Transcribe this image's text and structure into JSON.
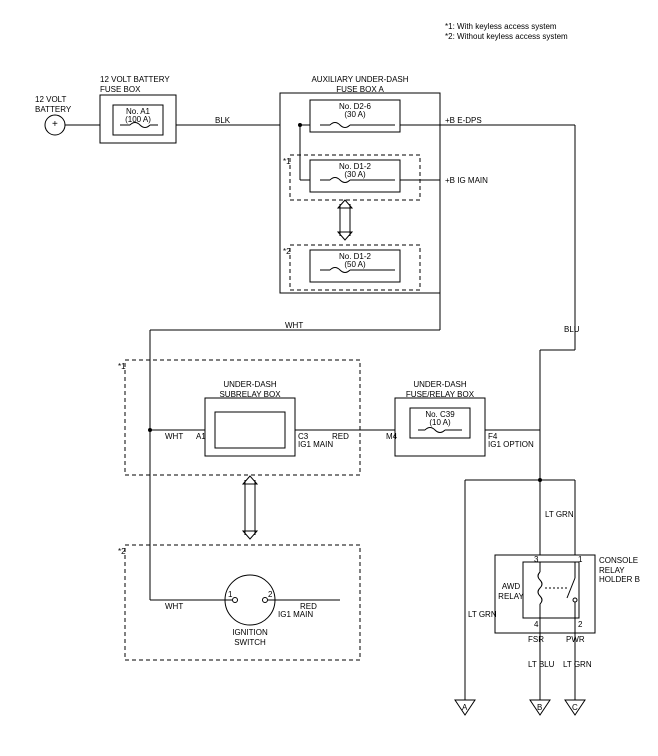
{
  "legend": {
    "note1": "*1: With keyless access system",
    "note2": "*2: Without keyless access system"
  },
  "battery": {
    "title": "12 VOLT\nBATTERY",
    "symbol": "+"
  },
  "battery_fuse_box": {
    "title": "12 VOLT BATTERY\nFUSE BOX",
    "fuse": {
      "name": "No. A1",
      "rating": "(100 A)"
    }
  },
  "aux_fuse_box": {
    "title": "AUXILIARY UNDER-DASH\nFUSE BOX A",
    "fuse1": {
      "name": "No. D2-6",
      "rating": "(30 A)",
      "out": "+B E-DPS"
    },
    "fuse2": {
      "name": "No. D1-2",
      "rating": "(30 A)",
      "out": "+B IG MAIN",
      "marker": "*1"
    },
    "fuse3": {
      "name": "No. D1-2",
      "rating": "(50 A)",
      "marker": "*2"
    }
  },
  "wires": {
    "blk": "BLK",
    "wht": "WHT",
    "red": "RED",
    "blu": "BLU",
    "ltgrn": "LT GRN",
    "ltblu": "LT BLU"
  },
  "subrelay_box": {
    "title": "UNDER-DASH\nSUBRELAY BOX",
    "marker": "*1",
    "pins": {
      "in": "A1",
      "out": "C3"
    },
    "out_label": "IG1 MAIN"
  },
  "fuse_relay_box": {
    "title": "UNDER-DASH\nFUSE/RELAY BOX",
    "fuse": {
      "name": "No. C39",
      "rating": "(10 A)"
    },
    "pins": {
      "in": "M4",
      "out": "F4"
    },
    "out_label": "IG1 OPTION"
  },
  "ignition": {
    "title": "IGNITION\nSWITCH",
    "marker": "*2",
    "pins": {
      "in": "1",
      "out": "2"
    },
    "out_label": "IG1 MAIN"
  },
  "relay_holder": {
    "title": "CONSOLE\nRELAY\nHOLDER B",
    "relay_name": "AWD\nRELAY",
    "pins": {
      "p1": "1",
      "p2": "2",
      "p3": "3",
      "p4": "4"
    },
    "labels": {
      "fsr": "FSR",
      "pwr": "PWR"
    }
  },
  "arrows": {
    "a": "A",
    "b": "B",
    "c": "C"
  }
}
